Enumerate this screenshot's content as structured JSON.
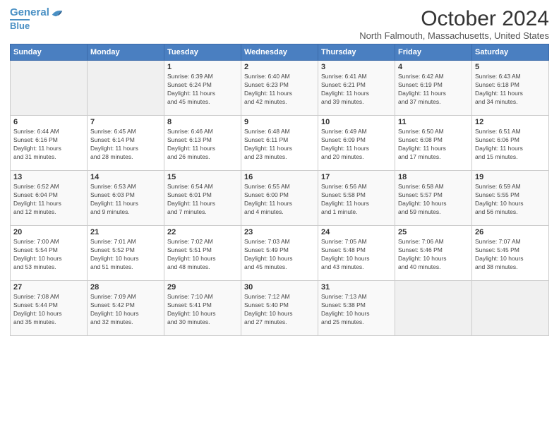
{
  "header": {
    "logo_line1": "General",
    "logo_line2": "Blue",
    "month": "October 2024",
    "location": "North Falmouth, Massachusetts, United States"
  },
  "weekdays": [
    "Sunday",
    "Monday",
    "Tuesday",
    "Wednesday",
    "Thursday",
    "Friday",
    "Saturday"
  ],
  "weeks": [
    [
      {
        "day": "",
        "info": ""
      },
      {
        "day": "",
        "info": ""
      },
      {
        "day": "1",
        "info": "Sunrise: 6:39 AM\nSunset: 6:24 PM\nDaylight: 11 hours\nand 45 minutes."
      },
      {
        "day": "2",
        "info": "Sunrise: 6:40 AM\nSunset: 6:23 PM\nDaylight: 11 hours\nand 42 minutes."
      },
      {
        "day": "3",
        "info": "Sunrise: 6:41 AM\nSunset: 6:21 PM\nDaylight: 11 hours\nand 39 minutes."
      },
      {
        "day": "4",
        "info": "Sunrise: 6:42 AM\nSunset: 6:19 PM\nDaylight: 11 hours\nand 37 minutes."
      },
      {
        "day": "5",
        "info": "Sunrise: 6:43 AM\nSunset: 6:18 PM\nDaylight: 11 hours\nand 34 minutes."
      }
    ],
    [
      {
        "day": "6",
        "info": "Sunrise: 6:44 AM\nSunset: 6:16 PM\nDaylight: 11 hours\nand 31 minutes."
      },
      {
        "day": "7",
        "info": "Sunrise: 6:45 AM\nSunset: 6:14 PM\nDaylight: 11 hours\nand 28 minutes."
      },
      {
        "day": "8",
        "info": "Sunrise: 6:46 AM\nSunset: 6:13 PM\nDaylight: 11 hours\nand 26 minutes."
      },
      {
        "day": "9",
        "info": "Sunrise: 6:48 AM\nSunset: 6:11 PM\nDaylight: 11 hours\nand 23 minutes."
      },
      {
        "day": "10",
        "info": "Sunrise: 6:49 AM\nSunset: 6:09 PM\nDaylight: 11 hours\nand 20 minutes."
      },
      {
        "day": "11",
        "info": "Sunrise: 6:50 AM\nSunset: 6:08 PM\nDaylight: 11 hours\nand 17 minutes."
      },
      {
        "day": "12",
        "info": "Sunrise: 6:51 AM\nSunset: 6:06 PM\nDaylight: 11 hours\nand 15 minutes."
      }
    ],
    [
      {
        "day": "13",
        "info": "Sunrise: 6:52 AM\nSunset: 6:04 PM\nDaylight: 11 hours\nand 12 minutes."
      },
      {
        "day": "14",
        "info": "Sunrise: 6:53 AM\nSunset: 6:03 PM\nDaylight: 11 hours\nand 9 minutes."
      },
      {
        "day": "15",
        "info": "Sunrise: 6:54 AM\nSunset: 6:01 PM\nDaylight: 11 hours\nand 7 minutes."
      },
      {
        "day": "16",
        "info": "Sunrise: 6:55 AM\nSunset: 6:00 PM\nDaylight: 11 hours\nand 4 minutes."
      },
      {
        "day": "17",
        "info": "Sunrise: 6:56 AM\nSunset: 5:58 PM\nDaylight: 11 hours\nand 1 minute."
      },
      {
        "day": "18",
        "info": "Sunrise: 6:58 AM\nSunset: 5:57 PM\nDaylight: 10 hours\nand 59 minutes."
      },
      {
        "day": "19",
        "info": "Sunrise: 6:59 AM\nSunset: 5:55 PM\nDaylight: 10 hours\nand 56 minutes."
      }
    ],
    [
      {
        "day": "20",
        "info": "Sunrise: 7:00 AM\nSunset: 5:54 PM\nDaylight: 10 hours\nand 53 minutes."
      },
      {
        "day": "21",
        "info": "Sunrise: 7:01 AM\nSunset: 5:52 PM\nDaylight: 10 hours\nand 51 minutes."
      },
      {
        "day": "22",
        "info": "Sunrise: 7:02 AM\nSunset: 5:51 PM\nDaylight: 10 hours\nand 48 minutes."
      },
      {
        "day": "23",
        "info": "Sunrise: 7:03 AM\nSunset: 5:49 PM\nDaylight: 10 hours\nand 45 minutes."
      },
      {
        "day": "24",
        "info": "Sunrise: 7:05 AM\nSunset: 5:48 PM\nDaylight: 10 hours\nand 43 minutes."
      },
      {
        "day": "25",
        "info": "Sunrise: 7:06 AM\nSunset: 5:46 PM\nDaylight: 10 hours\nand 40 minutes."
      },
      {
        "day": "26",
        "info": "Sunrise: 7:07 AM\nSunset: 5:45 PM\nDaylight: 10 hours\nand 38 minutes."
      }
    ],
    [
      {
        "day": "27",
        "info": "Sunrise: 7:08 AM\nSunset: 5:44 PM\nDaylight: 10 hours\nand 35 minutes."
      },
      {
        "day": "28",
        "info": "Sunrise: 7:09 AM\nSunset: 5:42 PM\nDaylight: 10 hours\nand 32 minutes."
      },
      {
        "day": "29",
        "info": "Sunrise: 7:10 AM\nSunset: 5:41 PM\nDaylight: 10 hours\nand 30 minutes."
      },
      {
        "day": "30",
        "info": "Sunrise: 7:12 AM\nSunset: 5:40 PM\nDaylight: 10 hours\nand 27 minutes."
      },
      {
        "day": "31",
        "info": "Sunrise: 7:13 AM\nSunset: 5:38 PM\nDaylight: 10 hours\nand 25 minutes."
      },
      {
        "day": "",
        "info": ""
      },
      {
        "day": "",
        "info": ""
      }
    ]
  ]
}
